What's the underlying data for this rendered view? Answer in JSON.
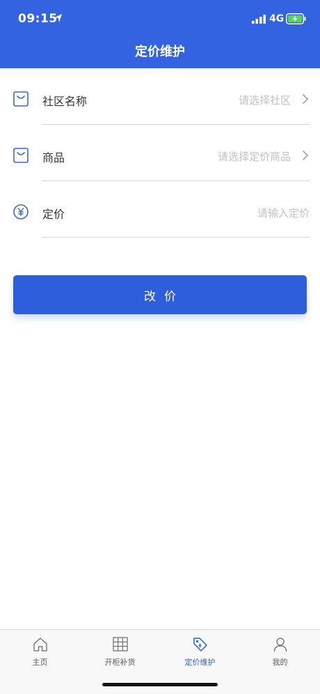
{
  "status_bar": {
    "time": "09:15",
    "network": "4G"
  },
  "nav": {
    "title": "定价维护"
  },
  "form": {
    "community": {
      "label": "社区名称",
      "placeholder": "请选择社区"
    },
    "product": {
      "label": "商品",
      "placeholder": "请选择定价商品"
    },
    "price": {
      "label": "定价",
      "placeholder": "请输入定价"
    }
  },
  "submit_label": "改价",
  "tabbar": {
    "items": [
      {
        "label": "主页",
        "icon": "home-icon"
      },
      {
        "label": "开柜补货",
        "icon": "cabinet-icon"
      },
      {
        "label": "定价维护",
        "icon": "price-tag-icon"
      },
      {
        "label": "我的",
        "icon": "user-icon"
      }
    ]
  },
  "colors": {
    "brand": "#3363e0",
    "button": "#2e5edc",
    "placeholder": "#c2c2c2"
  }
}
